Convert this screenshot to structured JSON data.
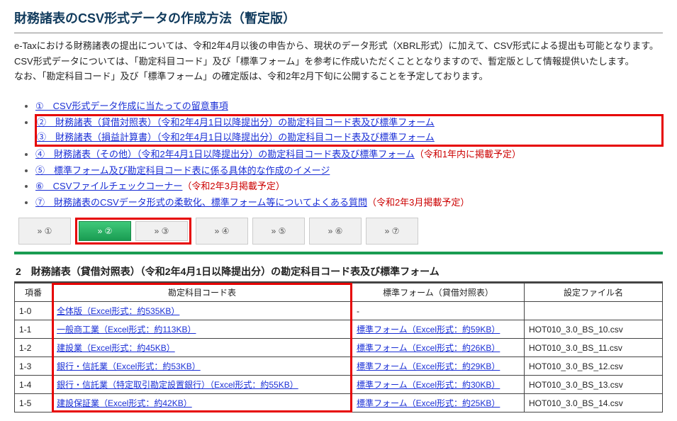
{
  "title": "財務諸表のCSV形式データの作成方法（暫定版）",
  "intro": {
    "p1": "e-Taxにおける財務諸表の提出については、令和2年4月以後の申告から、現状のデータ形式（XBRL形式）に加えて、CSV形式による提出も可能となります。",
    "p2": "CSV形式データについては、「勘定科目コード」及び「標準フォーム」を参考に作成いただくこととなりますので、暫定版として情報提供いたします。",
    "p3": "なお、「勘定科目コード」及び「標準フォーム」の確定版は、令和2年2月下旬に公開することを予定しております。"
  },
  "toc": [
    {
      "label": "①　CSV形式データ作成に当たっての留意事項",
      "note": ""
    },
    {
      "label": "②　財務諸表（貸借対照表）（令和2年4月1日以降提出分）の勘定科目コード表及び標準フォーム",
      "note": ""
    },
    {
      "label": "③　財務諸表（損益計算書）（令和2年4月1日以降提出分）の勘定科目コード表及び標準フォーム",
      "note": ""
    },
    {
      "label": "④　財務諸表（その他）（令和2年4月1日以降提出分）の勘定科目コード表及び標準フォーム",
      "note": "（令和1年内に掲載予定）"
    },
    {
      "label": "⑤　標準フォーム及び勘定科目コード表に係る具体的な作成のイメージ",
      "note": ""
    },
    {
      "label": "⑥　CSVファイルチェックコーナー",
      "note": "（令和2年3月掲載予定）"
    },
    {
      "label": "⑦　財務諸表のCSVデータ形式の柔軟化、標準フォーム等についてよくある質問",
      "note": "（令和2年3月掲載予定）"
    }
  ],
  "nav": {
    "items": [
      "» ①",
      "» ②",
      "» ③",
      "» ④",
      "» ⑤",
      "» ⑥",
      "» ⑦"
    ],
    "active_index": 1
  },
  "section2": {
    "heading": "2　財務諸表（貸借対照表）（令和2年4月1日以降提出分）の勘定科目コード表及び標準フォーム",
    "headers": {
      "num": "項番",
      "code": "勘定科目コード表",
      "form": "標準フォーム（貸借対照表）",
      "file": "設定ファイル名"
    },
    "rows": [
      {
        "num": "1-0",
        "code": "全体版（Excel形式：約535KB）",
        "form": "-",
        "file": ""
      },
      {
        "num": "1-1",
        "code": "一般商工業（Excel形式：約113KB）",
        "form": "標準フォーム（Excel形式：約59KB）",
        "file": "HOT010_3.0_BS_10.csv"
      },
      {
        "num": "1-2",
        "code": "建設業（Excel形式：約45KB）",
        "form": "標準フォーム（Excel形式：約26KB）",
        "file": "HOT010_3.0_BS_11.csv"
      },
      {
        "num": "1-3",
        "code": "銀行・信託業（Excel形式：約53KB）",
        "form": "標準フォーム（Excel形式：約29KB）",
        "file": "HOT010_3.0_BS_12.csv"
      },
      {
        "num": "1-4",
        "code": "銀行・信託業（特定取引勘定設置銀行）（Excel形式：約55KB）",
        "form": "標準フォーム（Excel形式：約30KB）",
        "file": "HOT010_3.0_BS_13.csv"
      },
      {
        "num": "1-5",
        "code": "建設保証業（Excel形式：約42KB）",
        "form": "標準フォーム（Excel形式：約25KB）",
        "file": "HOT010_3.0_BS_14.csv"
      }
    ]
  }
}
